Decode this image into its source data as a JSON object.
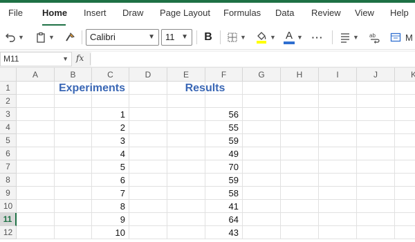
{
  "menu": {
    "items": [
      "File",
      "Home",
      "Insert",
      "Draw",
      "Page Layout",
      "Formulas",
      "Data",
      "Review",
      "View",
      "Help"
    ],
    "active": "Home"
  },
  "ribbon": {
    "font_name": "Calibri",
    "font_size": "11",
    "bold_label": "B",
    "font_color_label": "A",
    "more_label": "···",
    "truncated_label": "M"
  },
  "formula_bar": {
    "name_box": "M11",
    "fx_label": "fx",
    "value": ""
  },
  "sheet": {
    "columns": [
      "A",
      "B",
      "C",
      "D",
      "E",
      "F",
      "G",
      "H",
      "I",
      "J",
      "K"
    ],
    "rows": [
      "1",
      "2",
      "3",
      "4",
      "5",
      "6",
      "7",
      "8",
      "9",
      "10",
      "11",
      "12"
    ],
    "selected_row": "11",
    "header_experiments": "Experiments",
    "header_results": "Results",
    "experiments": [
      "1",
      "2",
      "3",
      "4",
      "5",
      "6",
      "7",
      "8",
      "9",
      "10"
    ],
    "results": [
      "56",
      "55",
      "59",
      "49",
      "70",
      "59",
      "58",
      "41",
      "64",
      "43"
    ]
  },
  "colors": {
    "accent": "#1e7145",
    "header_text": "#3a67b5",
    "highlight": "#ffff00",
    "font_color": "#2f6fd0"
  }
}
